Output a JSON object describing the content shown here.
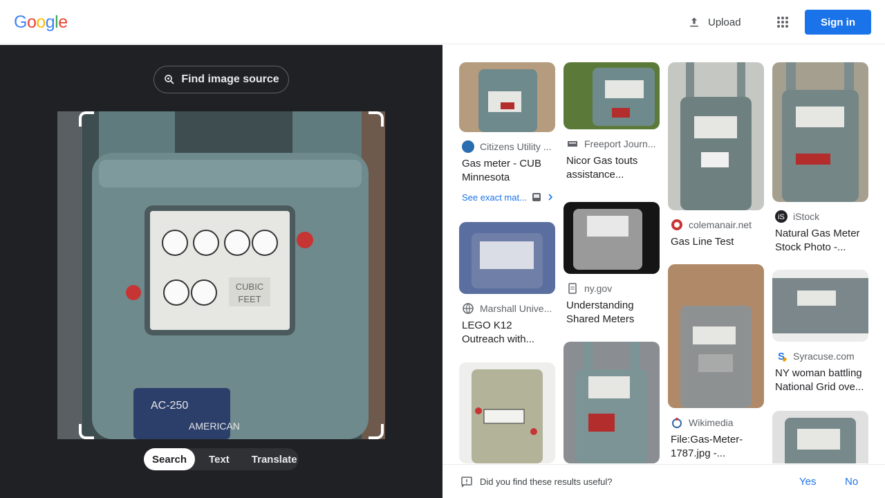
{
  "header": {
    "logo_text": "Google",
    "upload_label": "Upload",
    "signin_label": "Sign in"
  },
  "query_panel": {
    "find_source_label": "Find image source",
    "tabs": [
      {
        "label": "Search",
        "active": true
      },
      {
        "label": "Text",
        "active": false
      },
      {
        "label": "Translate",
        "active": false
      }
    ]
  },
  "results": [
    {
      "source": "Citizens Utility ...",
      "title": "Gas meter - CUB Minnesota",
      "exact_match": "See exact mat..."
    },
    {
      "source": "Freeport Journ...",
      "title": "Nicor Gas touts assistance..."
    },
    {
      "source": "colemanair.net",
      "title": "Gas Line Test"
    },
    {
      "source": "iStock",
      "title": "Natural Gas Meter Stock Photo -..."
    },
    {
      "source": "Marshall Unive...",
      "title": "LEGO K12 Outreach with..."
    },
    {
      "source": "ny.gov",
      "title": "Understanding Shared Meters"
    },
    {
      "source": "Wikimedia",
      "title": "File:Gas-Meter-1787.jpg -..."
    },
    {
      "source": "Syracuse.com",
      "title": "NY woman battling National Grid ove..."
    }
  ],
  "feedback": {
    "question": "Did you find these results useful?",
    "yes_label": "Yes",
    "no_label": "No"
  },
  "colors": {
    "accent": "#1a73e8",
    "dark_panel": "#202124",
    "meter_teal": "#6f8a8c"
  },
  "icons": {
    "upload": "upload-icon",
    "apps": "apps-grid-icon",
    "lens": "lens-search-icon",
    "feedback": "feedback-icon"
  }
}
